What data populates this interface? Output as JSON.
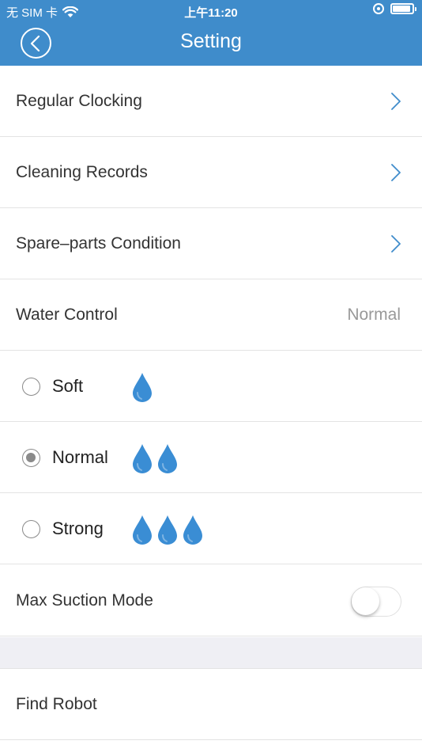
{
  "status_bar": {
    "carrier": "无 SIM 卡",
    "time": "上午11:20"
  },
  "header": {
    "title": "Setting"
  },
  "menu": {
    "regular_clocking": "Regular Clocking",
    "cleaning_records": "Cleaning Records",
    "spare_parts": "Spare–parts Condition"
  },
  "water_control": {
    "label": "Water Control",
    "value": "Normal",
    "options": [
      {
        "label": "Soft",
        "drops": 1,
        "selected": false
      },
      {
        "label": "Normal",
        "drops": 2,
        "selected": true
      },
      {
        "label": "Strong",
        "drops": 3,
        "selected": false
      }
    ]
  },
  "max_suction": {
    "label": "Max Suction Mode",
    "enabled": false
  },
  "find_robot": {
    "label": "Find Robot"
  },
  "colors": {
    "header": "#3f8ccb",
    "drop": "#3a8dd4",
    "radio": "#8a8a8a"
  },
  "icons": {
    "back": "chevron-left-circle-icon",
    "row_arrow": "chevron-right-icon",
    "water": "water-drop-icon"
  }
}
